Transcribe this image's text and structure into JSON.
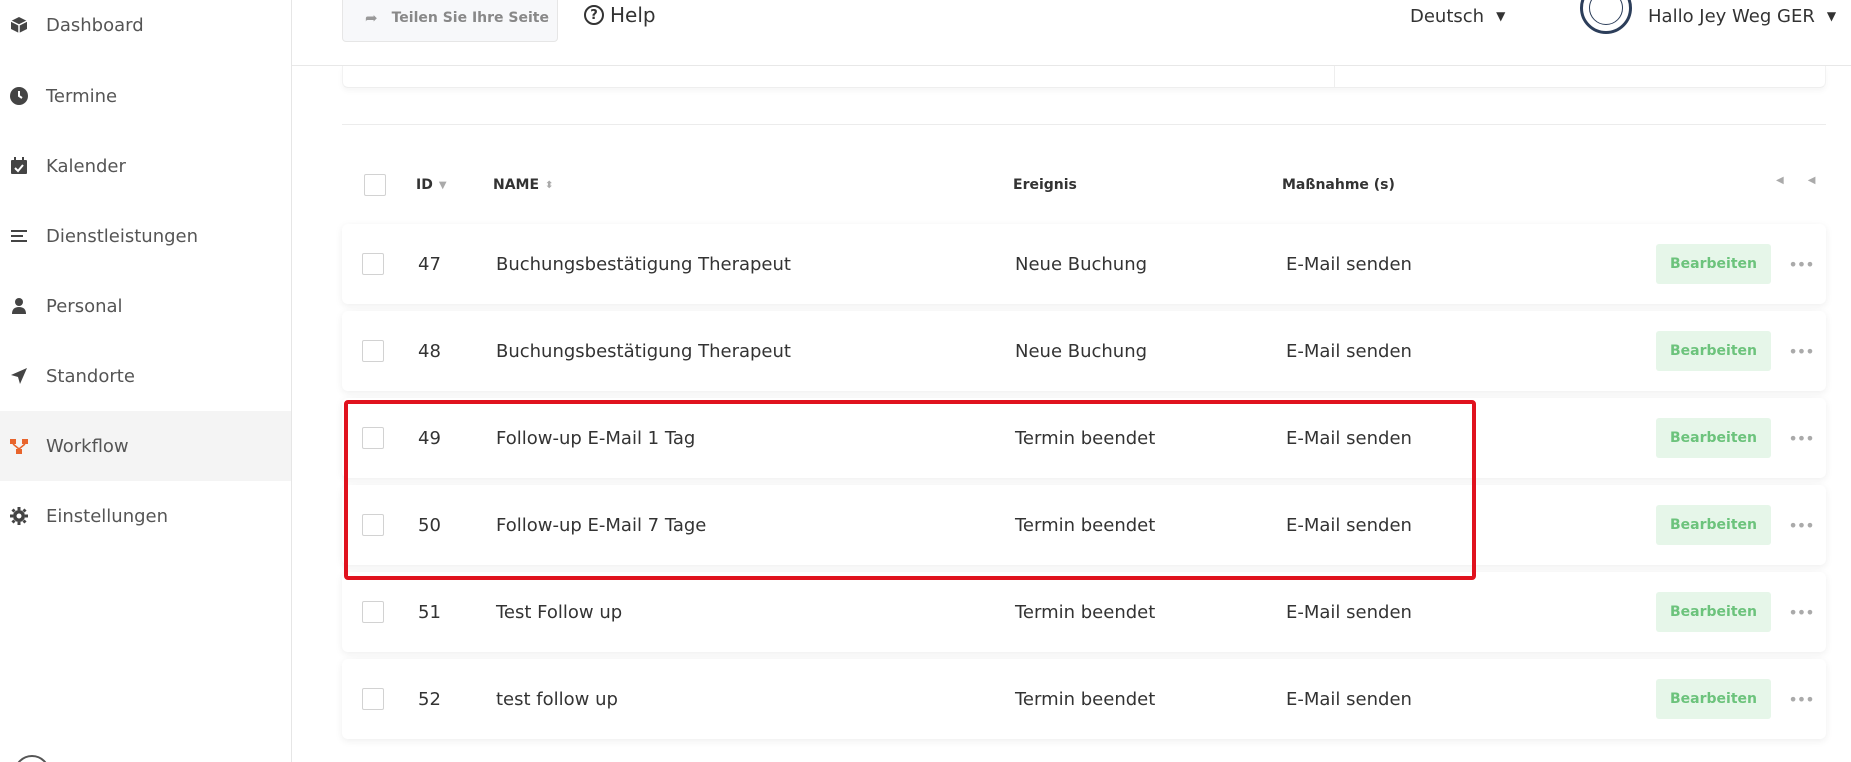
{
  "sidebar": {
    "items": [
      {
        "label": "Dashboard",
        "icon": "box-icon"
      },
      {
        "label": "Termine",
        "icon": "clock-icon"
      },
      {
        "label": "Kalender",
        "icon": "calendar-icon"
      },
      {
        "label": "Dienstleistungen",
        "icon": "list-icon"
      },
      {
        "label": "Personal",
        "icon": "person-icon"
      },
      {
        "label": "Standorte",
        "icon": "location-arrow-icon"
      },
      {
        "label": "Workflow",
        "icon": "workflow-icon",
        "active": true
      },
      {
        "label": "Einstellungen",
        "icon": "gear-icon"
      }
    ]
  },
  "topbar": {
    "share_label": "Teilen Sie Ihre Seite",
    "help_label": "Help",
    "language": "Deutsch",
    "user_greeting": "Hallo Jey Weg GER"
  },
  "table": {
    "headers": {
      "id": "ID",
      "name": "NAME",
      "event": "Ereignis",
      "action": "Maßnahme (s)"
    },
    "edit_label": "Bearbeiten",
    "rows": [
      {
        "id": "47",
        "name": "Buchungsbestätigung Therapeut",
        "event": "Neue Buchung",
        "action": "E-Mail senden"
      },
      {
        "id": "48",
        "name": "Buchungsbestätigung Therapeut",
        "event": "Neue Buchung",
        "action": "E-Mail senden"
      },
      {
        "id": "49",
        "name": "Follow-up E-Mail 1 Tag",
        "event": "Termin beendet",
        "action": "E-Mail senden"
      },
      {
        "id": "50",
        "name": "Follow-up E-Mail 7 Tage",
        "event": "Termin beendet",
        "action": "E-Mail senden"
      },
      {
        "id": "51",
        "name": "Test Follow up",
        "event": "Termin beendet",
        "action": "E-Mail senden"
      },
      {
        "id": "52",
        "name": "test follow up",
        "event": "Termin beendet",
        "action": "E-Mail senden"
      }
    ]
  },
  "colors": {
    "accent_workflow": "#e8642c",
    "edit_bg": "#e6f6e9",
    "edit_text": "#6cc37c",
    "highlight": "#e0121e"
  }
}
